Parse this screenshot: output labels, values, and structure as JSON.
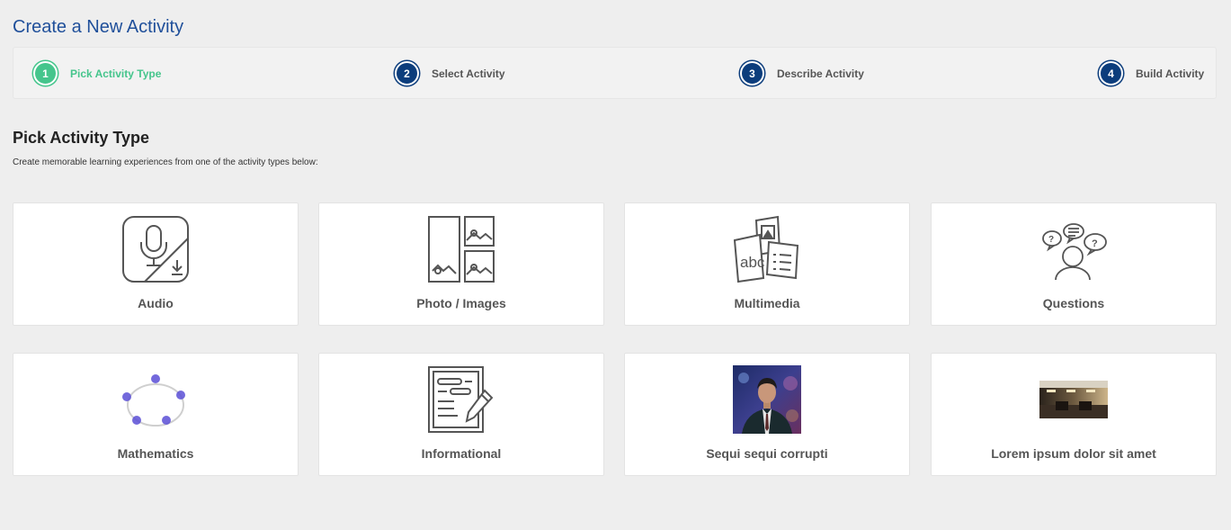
{
  "page": {
    "title": "Create a New Activity"
  },
  "stepper": {
    "steps": [
      {
        "number": "1",
        "label": "Pick Activity Type",
        "active": true
      },
      {
        "number": "2",
        "label": "Select Activity",
        "active": false
      },
      {
        "number": "3",
        "label": "Describe Activity",
        "active": false
      },
      {
        "number": "4",
        "label": "Build Activity",
        "active": false
      }
    ]
  },
  "section": {
    "title": "Pick Activity Type",
    "subtitle": "Create memorable learning experiences from one of the activity types below:"
  },
  "cards": [
    {
      "label": "Audio",
      "icon": "microphone-download-icon"
    },
    {
      "label": "Photo / Images",
      "icon": "photo-gallery-icon"
    },
    {
      "label": "Multimedia",
      "icon": "multimedia-documents-icon"
    },
    {
      "label": "Questions",
      "icon": "person-questions-icon"
    },
    {
      "label": "Mathematics",
      "icon": "math-polygon-icon"
    },
    {
      "label": "Informational",
      "icon": "document-pencil-icon"
    },
    {
      "label": "Sequi sequi corrupti",
      "icon": "person-photo-thumbnail"
    },
    {
      "label": "Lorem ipsum dolor sit amet",
      "icon": "interior-photo-thumbnail"
    }
  ],
  "colors": {
    "title_blue": "#1f4f9a",
    "step_active": "#45c58c",
    "step_inactive": "#0c3d7c",
    "math_points": "#5b4fd6"
  }
}
